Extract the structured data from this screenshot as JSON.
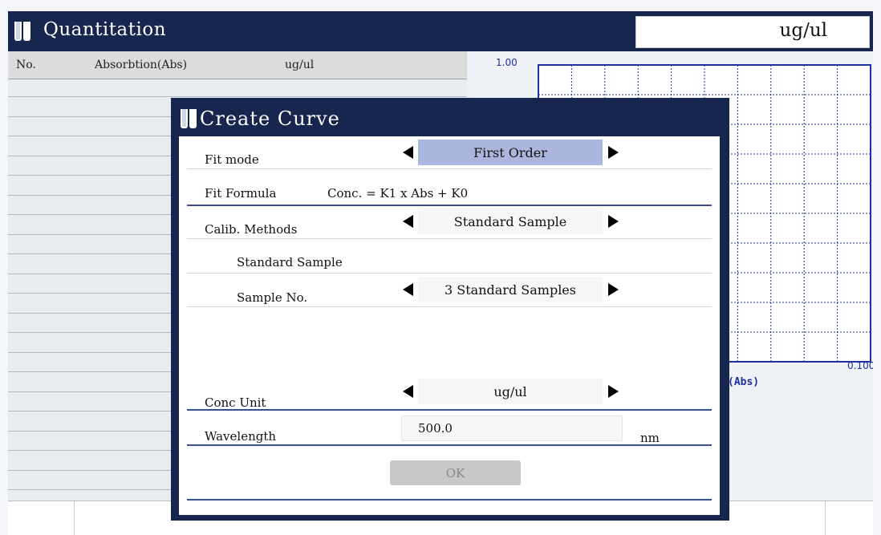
{
  "window": {
    "title": "Quantitation",
    "unit": "ug/ul"
  },
  "table": {
    "columns": [
      "No.",
      "Absorbtion(Abs)",
      "ug/ul"
    ]
  },
  "chart": {
    "y_max_label": "1.00",
    "x_max_label": "0.100",
    "x_axis_label": "(Abs)",
    "grid": true
  },
  "dialog": {
    "title": "Create Curve",
    "fit_mode": {
      "label": "Fit mode",
      "value": "First Order"
    },
    "fit_formula": {
      "label": "Fit Formula",
      "value": "Conc. = K1 x Abs + K0"
    },
    "calib_methods": {
      "label": "Calib. Methods",
      "value": "Standard Sample"
    },
    "standard_sample_label": "Standard Sample",
    "sample_no": {
      "label": "Sample No.",
      "value": "3 Standard Samples"
    },
    "conc_unit": {
      "label": "Conc Unit",
      "value": "ug/ul"
    },
    "wavelength": {
      "label": "Wavelength",
      "value": "500.0",
      "unit": "nm"
    },
    "ok_label": "OK"
  },
  "colors": {
    "titlebar": "#17264f",
    "highlight": "#aab6dd",
    "accent_line": "#3b4f8c",
    "chart_frame": "#1e2fa0"
  },
  "icons": [
    "test-tube-icon",
    "arrow-left-icon",
    "arrow-right-icon"
  ]
}
